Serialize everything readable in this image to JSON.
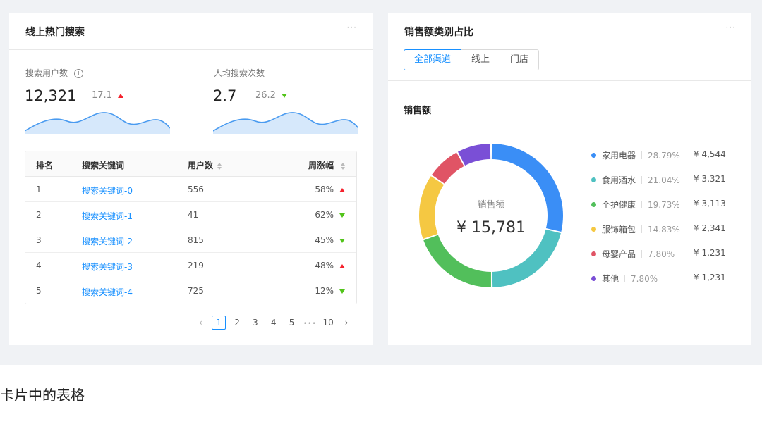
{
  "left_card": {
    "title": "线上热门搜索",
    "more": "···",
    "stat1": {
      "label": "搜索用户数",
      "value": "12,321",
      "change": "17.1",
      "trend": "up"
    },
    "stat2": {
      "label": "人均搜索次数",
      "value": "2.7",
      "change": "26.2",
      "trend": "down"
    },
    "table": {
      "headers": [
        "排名",
        "搜索关键词",
        "用户数",
        "周涨幅"
      ],
      "rows": [
        {
          "rank": "1",
          "keyword": "搜索关键词-0",
          "users": "556",
          "change": "58%",
          "trend": "up"
        },
        {
          "rank": "2",
          "keyword": "搜索关键词-1",
          "users": "41",
          "change": "62%",
          "trend": "down"
        },
        {
          "rank": "3",
          "keyword": "搜索关键词-2",
          "users": "815",
          "change": "45%",
          "trend": "down"
        },
        {
          "rank": "4",
          "keyword": "搜索关键词-3",
          "users": "219",
          "change": "48%",
          "trend": "up"
        },
        {
          "rank": "5",
          "keyword": "搜索关键词-4",
          "users": "725",
          "change": "12%",
          "trend": "down"
        }
      ]
    },
    "pagination": {
      "prev": "‹",
      "pages": [
        "1",
        "2",
        "3",
        "4",
        "5"
      ],
      "ellipsis": "•••",
      "last": "10",
      "next": "›",
      "current": "1"
    }
  },
  "right_card": {
    "title": "销售额类别占比",
    "more": "···",
    "tabs": [
      "全部渠道",
      "线上",
      "门店"
    ],
    "active_tab": "全部渠道",
    "section_title": "销售额",
    "center_label": "销售额",
    "center_value": "¥ 15,781",
    "legend": [
      {
        "name": "家用电器",
        "percent": "28.79%",
        "amount": "¥ 4,544",
        "color": "#3a8ef6"
      },
      {
        "name": "食用酒水",
        "percent": "21.04%",
        "amount": "¥ 3,321",
        "color": "#4fc1c1"
      },
      {
        "name": "个护健康",
        "percent": "19.73%",
        "amount": "¥ 3,113",
        "color": "#52bf5b"
      },
      {
        "name": "服饰箱包",
        "percent": "14.83%",
        "amount": "¥ 2,341",
        "color": "#f5c842"
      },
      {
        "name": "母婴产品",
        "percent": "7.80%",
        "amount": "¥ 1,231",
        "color": "#e05465"
      },
      {
        "name": "其他",
        "percent": "7.80%",
        "amount": "¥ 1,231",
        "color": "#7a4fd6"
      }
    ]
  },
  "chart_data": {
    "type": "pie",
    "categories": [
      "家用电器",
      "食用酒水",
      "个护健康",
      "服饰箱包",
      "母婴产品",
      "其他"
    ],
    "values": [
      28.79,
      21.04,
      19.73,
      14.83,
      7.8,
      7.8
    ],
    "title": "销售额"
  },
  "caption": "卡片中的表格"
}
